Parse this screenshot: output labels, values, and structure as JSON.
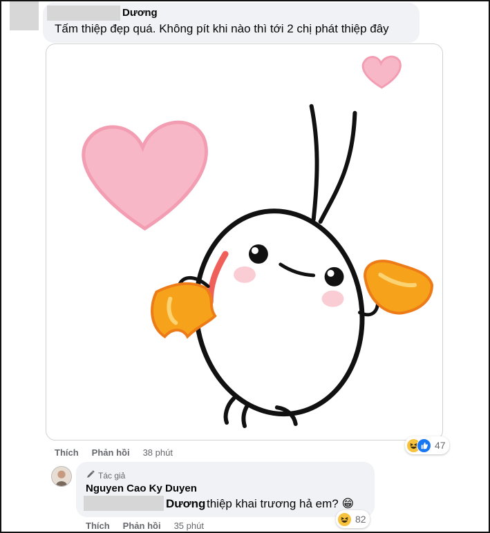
{
  "comment1": {
    "name": "Dương",
    "text": "Tấm thiệp đẹp quá. Không pít khi nào thì tới 2 chị phát thiệp đây",
    "actions": {
      "like": "Thích",
      "reply": "Phản hồi",
      "time": "38 phút"
    },
    "reaction_count": "47",
    "reaction_icons": [
      "haha-icon",
      "like-icon"
    ]
  },
  "sticker": {
    "description_icon": "shrimp-sticker-with-hearts"
  },
  "reply": {
    "author_badge": "Tác giả",
    "name": "Nguyen Cao Ky Duyen",
    "mention": "Dương",
    "text": "thiệp khai trương hả em? 😁",
    "actions": {
      "like": "Thích",
      "reply": "Phản hồi",
      "time": "35 phút"
    },
    "reaction_count": "82",
    "reaction_icons": [
      "haha-icon"
    ]
  },
  "colors": {
    "bubble": "#f0f2f5",
    "secondary_text": "#65676b",
    "like_blue": "#1877f2",
    "haha_yellow": "#f7c33e",
    "heart_pink": "#f7b7c6",
    "claw_orange": "#f7a21b"
  }
}
